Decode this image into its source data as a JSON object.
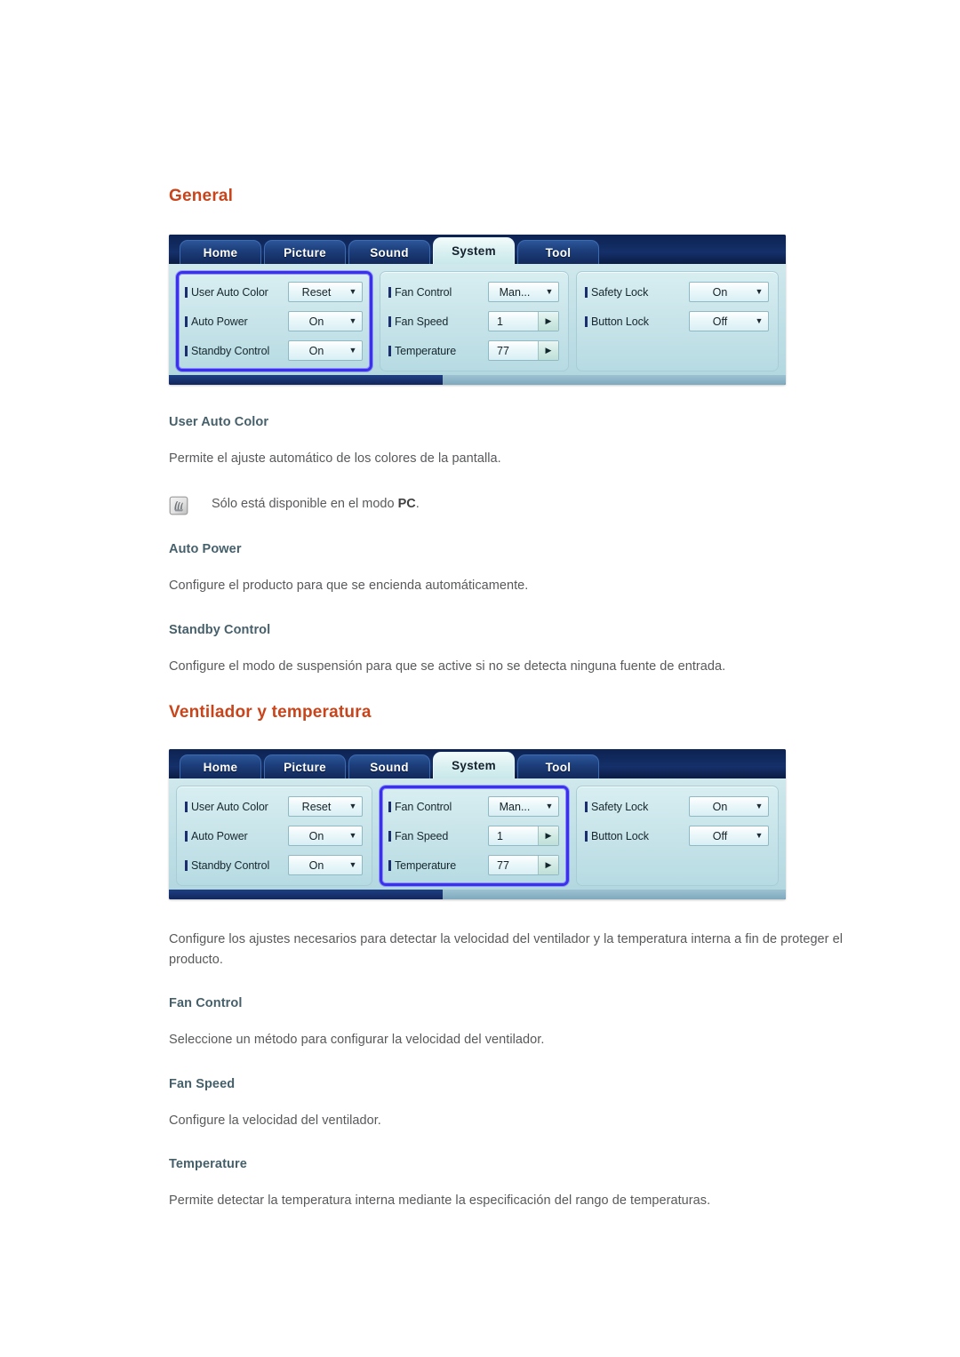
{
  "sections": [
    {
      "title": "General",
      "osd": {
        "tabs": [
          {
            "label": "Home",
            "active": false
          },
          {
            "label": "Picture",
            "active": false
          },
          {
            "label": "Sound",
            "active": false
          },
          {
            "label": "System",
            "active": true
          },
          {
            "label": "Tool",
            "active": false
          }
        ],
        "highlight_group": 0,
        "groups": [
          {
            "rows": [
              {
                "label": "User Auto Color",
                "value": "Reset",
                "control": "dropdown"
              },
              {
                "label": "Auto Power",
                "value": "On",
                "control": "dropdown"
              },
              {
                "label": "Standby Control",
                "value": "On",
                "control": "dropdown"
              }
            ]
          },
          {
            "rows": [
              {
                "label": "Fan Control",
                "value": "Man...",
                "control": "dropdown"
              },
              {
                "label": "Fan Speed",
                "value": "1",
                "control": "spinner"
              },
              {
                "label": "Temperature",
                "value": "77",
                "control": "spinner"
              }
            ]
          },
          {
            "rows": [
              {
                "label": "Safety Lock",
                "value": "On",
                "control": "dropdown"
              },
              {
                "label": "Button Lock",
                "value": "Off",
                "control": "dropdown"
              }
            ]
          }
        ]
      },
      "blocks": [
        {
          "kind": "subtitle",
          "text": "User Auto Color"
        },
        {
          "kind": "paragraph",
          "text": "Permite el ajuste automático de los colores de la pantalla."
        },
        {
          "kind": "note",
          "text_before": "Sólo está disponible en el modo ",
          "bold": "PC",
          "text_after": "."
        },
        {
          "kind": "subtitle",
          "text": "Auto Power"
        },
        {
          "kind": "paragraph",
          "text": "Configure el producto para que se encienda automáticamente."
        },
        {
          "kind": "subtitle",
          "text": "Standby Control"
        },
        {
          "kind": "paragraph",
          "text": "Configure el modo de suspensión para que se active si no se detecta ninguna fuente de entrada."
        }
      ]
    },
    {
      "title": "Ventilador y temperatura",
      "osd": {
        "tabs": [
          {
            "label": "Home",
            "active": false
          },
          {
            "label": "Picture",
            "active": false
          },
          {
            "label": "Sound",
            "active": false
          },
          {
            "label": "System",
            "active": true
          },
          {
            "label": "Tool",
            "active": false
          }
        ],
        "highlight_group": 1,
        "groups": [
          {
            "rows": [
              {
                "label": "User Auto Color",
                "value": "Reset",
                "control": "dropdown"
              },
              {
                "label": "Auto Power",
                "value": "On",
                "control": "dropdown"
              },
              {
                "label": "Standby Control",
                "value": "On",
                "control": "dropdown"
              }
            ]
          },
          {
            "rows": [
              {
                "label": "Fan Control",
                "value": "Man...",
                "control": "dropdown"
              },
              {
                "label": "Fan Speed",
                "value": "1",
                "control": "spinner"
              },
              {
                "label": "Temperature",
                "value": "77",
                "control": "spinner"
              }
            ]
          },
          {
            "rows": [
              {
                "label": "Safety Lock",
                "value": "On",
                "control": "dropdown"
              },
              {
                "label": "Button Lock",
                "value": "Off",
                "control": "dropdown"
              }
            ]
          }
        ]
      },
      "blocks": [
        {
          "kind": "paragraph",
          "text": "Configure los ajustes necesarios para detectar la velocidad del ventilador y la temperatura interna a fin de proteger el producto."
        },
        {
          "kind": "subtitle",
          "text": "Fan Control"
        },
        {
          "kind": "paragraph",
          "text": "Seleccione un método para configurar la velocidad del ventilador."
        },
        {
          "kind": "subtitle",
          "text": "Fan Speed"
        },
        {
          "kind": "paragraph",
          "text": "Configure la velocidad del ventilador."
        },
        {
          "kind": "subtitle",
          "text": "Temperature"
        },
        {
          "kind": "paragraph",
          "text": "Permite detectar la temperatura interna mediante la especificación del rango de temperaturas."
        }
      ]
    }
  ],
  "icons": {
    "dropdown_caret": "▼",
    "spinner_arrow": "▶",
    "note_icon": "note-pen-icon"
  },
  "colors": {
    "heading": "#c8441b",
    "subheading": "#46606b",
    "body": "#58595b",
    "highlight_border": "#3b30f0",
    "osd_header": "#12295b"
  }
}
